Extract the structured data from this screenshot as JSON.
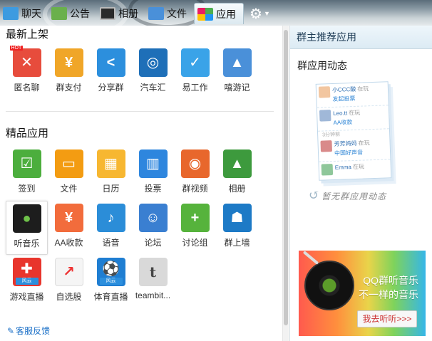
{
  "tabs": [
    {
      "label": "聊天",
      "icon": "chat-icon"
    },
    {
      "label": "公告",
      "icon": "notice-icon"
    },
    {
      "label": "相册",
      "icon": "album-icon"
    },
    {
      "label": "文件",
      "icon": "folder-icon"
    },
    {
      "label": "应用",
      "icon": "apps-icon",
      "active": true
    }
  ],
  "sections": {
    "new": {
      "title": "最新上架",
      "apps": [
        {
          "label": "匿名聊",
          "icon": "anonymous-chat-icon",
          "badge": "HOT"
        },
        {
          "label": "群支付",
          "icon": "group-pay-icon"
        },
        {
          "label": "分享群",
          "icon": "share-icon"
        },
        {
          "label": "汽车汇",
          "icon": "car-icon"
        },
        {
          "label": "易工作",
          "icon": "work-icon"
        },
        {
          "label": "嘻游记",
          "icon": "xiyouji-icon"
        }
      ]
    },
    "featured": {
      "title": "精品应用",
      "apps": [
        {
          "label": "签到",
          "icon": "check-in-icon"
        },
        {
          "label": "文件",
          "icon": "file-folder-icon"
        },
        {
          "label": "日历",
          "icon": "calendar-icon"
        },
        {
          "label": "投票",
          "icon": "vote-chart-icon"
        },
        {
          "label": "群视频",
          "icon": "video-camera-icon"
        },
        {
          "label": "相册",
          "icon": "photo-album-icon"
        },
        {
          "label": "听音乐",
          "icon": "music-disc-icon",
          "selected": true
        },
        {
          "label": "AA收款",
          "icon": "aa-payment-icon"
        },
        {
          "label": "语音",
          "icon": "microphone-icon"
        },
        {
          "label": "论坛",
          "icon": "forum-icon"
        },
        {
          "label": "讨论组",
          "icon": "discussion-icon"
        },
        {
          "label": "群上墙",
          "icon": "projector-icon"
        },
        {
          "label": "游戏直播",
          "icon": "game-controller-icon",
          "badge": "风云"
        },
        {
          "label": "自选股",
          "icon": "stock-chart-icon"
        },
        {
          "label": "体育直播",
          "icon": "soccer-ball-icon",
          "badge": "风云"
        },
        {
          "label": "teambit...",
          "icon": "teambition-icon"
        }
      ]
    }
  },
  "feedback": "客服反馈",
  "right": {
    "header": "群主推荐应用",
    "subheader": "群应用动态",
    "feed": [
      {
        "name": "小CCC酸",
        "status": "在玩",
        "action": "发起投票"
      },
      {
        "name": "Leo.tt",
        "status": "在玩",
        "action": "AA收款"
      },
      {
        "name": "芳芳妈妈",
        "status": "在玩",
        "action": "中国好声音"
      },
      {
        "name": "Emma",
        "status": "在玩",
        "action": ""
      }
    ],
    "feed_time": "3分钟前",
    "empty_text": "暂无群应用动态",
    "banner": {
      "line1": "QQ群听音乐",
      "line2": "不一样的音乐",
      "button": "我去听听>>>"
    }
  }
}
